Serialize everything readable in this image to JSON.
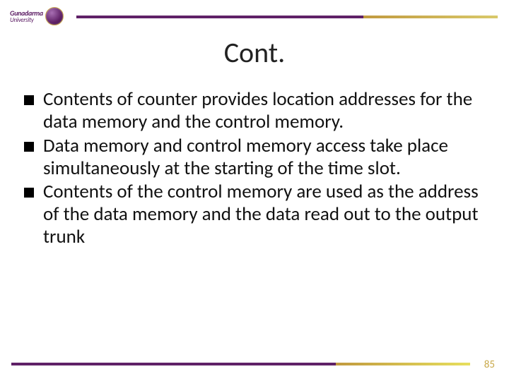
{
  "logo": {
    "name": "Gunadarma",
    "sub": "University"
  },
  "title": "Cont.",
  "bullets": [
    "Contents of counter provides location addresses for the data memory and the control memory.",
    "Data memory and control memory access take place simultaneously at the starting of the time slot.",
    "Contents of the control memory are used as the address of the data memory and the data read out to the output trunk"
  ],
  "page_number": "85",
  "colors": {
    "brand_purple": "#5f2167",
    "accent_gold": "#c9a94a"
  }
}
